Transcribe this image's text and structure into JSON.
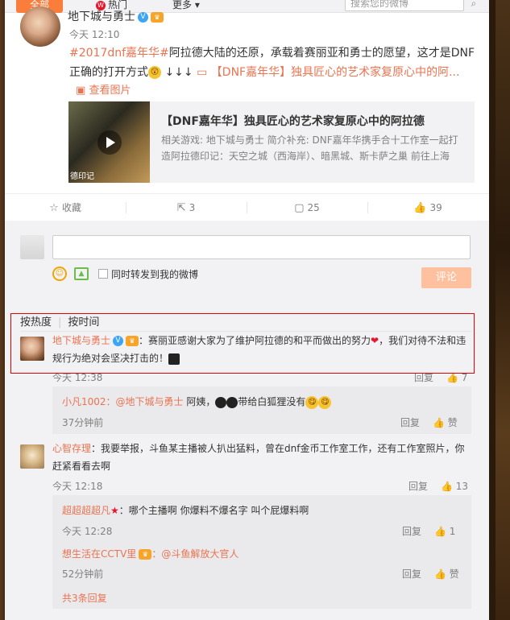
{
  "tabs": {
    "all": "全部",
    "hot": "热门",
    "more": "更多"
  },
  "search": {
    "placeholder": "搜索您的微博"
  },
  "post": {
    "author": "地下城与勇士",
    "time": "今天 12:10",
    "hashtag": "#2017dnf嘉年华#",
    "text_main": "阿拉德大陆的还原，承载着赛丽亚和勇士的愿望，这才是DNF正确的打开方式",
    "arrows": "↓↓↓",
    "link_text": "【DNF嘉年华】独具匠心的艺术家复原心中的阿...",
    "view_image": "查看图片",
    "card": {
      "title": "【DNF嘉年华】独具匠心的艺术家复原心中的阿拉德",
      "desc": "相关游戏: 地下城与勇士 简介补充: DNF嘉年华携手合十工作室一起打造阿拉德印记：天空之城（西海岸）、暗黑城、斯卡萨之巢 前往上海",
      "thumb_caption": "德印记"
    }
  },
  "actions": {
    "favorite": "收藏",
    "repost": "3",
    "comment": "25",
    "like": "39"
  },
  "composer": {
    "repost_label": "同时转发到我的微博",
    "submit": "评论"
  },
  "sort": {
    "hot": "按热度",
    "time": "按时间"
  },
  "comments": [
    {
      "name": "地下城与勇士",
      "text": "：赛丽亚感谢大家为了维护阿拉德的和平而做出的努力",
      "text2": "，我们对待不法和违规行为绝对会坚决打击的！",
      "time": "今天 12:38",
      "reply": "回复",
      "likes": "7"
    },
    {
      "name": "心智存理",
      "text": "：我要举报，斗鱼某主播被人扒出猛料，曾在dnf金币工作室工作，还有工作室照片，你赶紧看看去啊",
      "time": "今天 12:18",
      "reply": "回复",
      "likes": "13"
    }
  ],
  "replies_a": [
    {
      "name": "小凡1002",
      "mention": "：@地下城与勇士",
      "text": " 阿姨，",
      "text2": "带给白狐狸没有",
      "time": "37分钟前",
      "reply": "回复",
      "like": "赞"
    }
  ],
  "replies_b": [
    {
      "name": "超超超超凡",
      "text": "：哪个主播啊 你爆料不爆名字 叫个屁爆料啊",
      "time": "今天 12:28",
      "reply": "回复",
      "likes": "1"
    },
    {
      "name": "想生活在CCTV里",
      "text": "：@斗鱼解放大官人",
      "time": "52分钟前",
      "reply": "回复",
      "like": "赞"
    }
  ],
  "more_replies": "共3条回复",
  "colors": {
    "accent": "#eb7350",
    "tab_active": "#fa7d3c",
    "highlight_border": "#e00000",
    "submit_disabled": "#ffc09f"
  }
}
